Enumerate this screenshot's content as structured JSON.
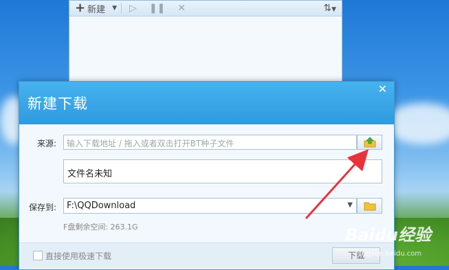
{
  "main_window": {
    "toolbar": {
      "new_label": "新建"
    }
  },
  "dialog": {
    "title": "新建下载",
    "close_glyph": "✕",
    "source_label": "来源:",
    "source_placeholder": "输入下载地址 / 拖入或者双击打开BT种子文件",
    "filename": "文件名未知",
    "save_label": "保存到:",
    "save_path": "F:\\QQDownload",
    "free_space": "F盘剩余空间: 263.1G",
    "fast_download_label": "直接使用极速下载",
    "download_button": "下载"
  },
  "watermark": {
    "brand": "Baidu经验",
    "sub": "jingyan.baidu.com"
  },
  "colors": {
    "title_bar": "#2f9be0",
    "arrow": "#e8333a",
    "folder": "#f0c23a"
  }
}
